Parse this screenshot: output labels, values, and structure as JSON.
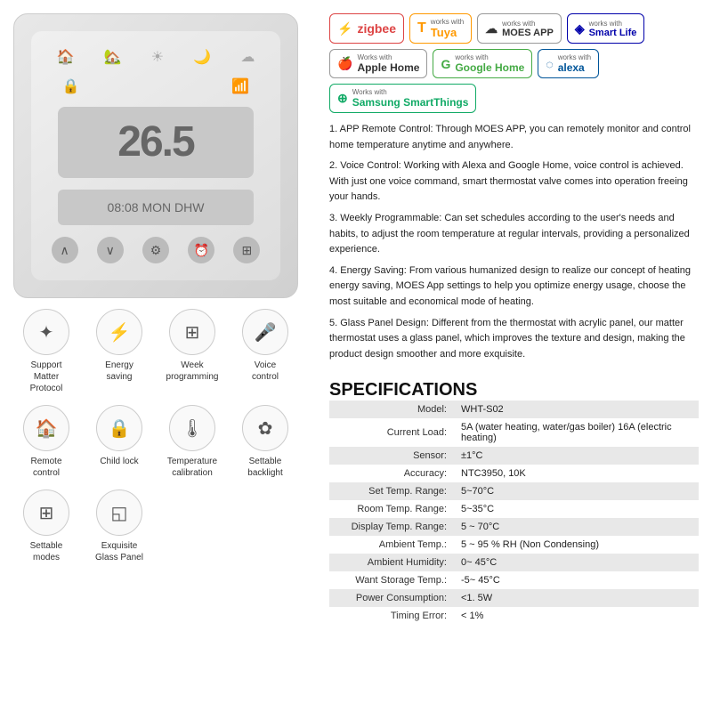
{
  "badges": {
    "row1": [
      {
        "label": "zigbee",
        "icon": "⚡",
        "text": "zigbee",
        "class": "zigbee"
      },
      {
        "label": "tuya",
        "icon": "T",
        "text": "works with\nTuya",
        "class": "tuya"
      },
      {
        "label": "moes",
        "icon": "☁",
        "text": "works with\nMOES APP",
        "class": "moes"
      },
      {
        "label": "smartlife",
        "icon": "◈",
        "text": "works with\nSmart Life",
        "class": "smartlife"
      }
    ],
    "row2": [
      {
        "label": "apple",
        "icon": "🍎",
        "text": "Works with\nApple Home",
        "class": "apple"
      },
      {
        "label": "google",
        "icon": "G",
        "text": "works with\nGoogle Home",
        "class": "google"
      },
      {
        "label": "alexa",
        "icon": "◌",
        "text": "works\nwith alexa",
        "class": "alexa"
      }
    ],
    "row3": [
      {
        "label": "samsung",
        "icon": "⊕",
        "text": "Works with\nSamsung SmartThings",
        "class": "samsung"
      }
    ]
  },
  "description": {
    "items": [
      "1. APP Remote Control: Through MOES APP, you can remotely monitor and control home temperature anytime and anywhere.",
      "2. Voice Control: Working with Alexa and Google Home, voice control is achieved. With just one voice command, smart thermostat valve comes into operation freeing your hands.",
      "3. Weekly Programmable: Can set schedules according to the user's needs and habits, to adjust the room temperature at regular intervals, providing a personalized experience.",
      "4. Energy Saving: From various humanized design to realize our concept of heating energy saving, MOES App settings to help you optimize energy usage, choose the most suitable and economical mode of heating.",
      "5. Glass Panel Design: Different from the thermostat with acrylic panel, our matter thermostat uses a glass panel, which improves the texture and design, making the product design smoother and more exquisite."
    ]
  },
  "specs": {
    "title": "SPECIFICATIONS",
    "rows": [
      {
        "label": "Model:",
        "value": "WHT-S02"
      },
      {
        "label": "Current Load:",
        "value": "5A (water heating, water/gas boiler)\n16A (electric heating)"
      },
      {
        "label": "Sensor:",
        "value": "±1°C"
      },
      {
        "label": "Accuracy:",
        "value": "NTC3950, 10K"
      },
      {
        "label": "Set Temp. Range:",
        "value": "5~70°C"
      },
      {
        "label": "Room Temp. Range:",
        "value": "5~35°C"
      },
      {
        "label": "Display Temp. Range:",
        "value": "5 ~ 70°C"
      },
      {
        "label": "Ambient Temp.:",
        "value": "5 ~ 95 % RH (Non Condensing)"
      },
      {
        "label": "Ambient Humidity:",
        "value": "0~ 45°C"
      },
      {
        "label": "Want Storage Temp.:",
        "value": "-5~ 45°C"
      },
      {
        "label": "Power Consumption:",
        "value": "<1. 5W"
      },
      {
        "label": "Timing Error:",
        "value": "< 1%"
      }
    ]
  },
  "features": {
    "row1": [
      {
        "label": "Support\nMatter Protocol",
        "icon": "✦"
      },
      {
        "label": "Energy\nsaving",
        "icon": "⚡"
      },
      {
        "label": "Week\nprogramming",
        "icon": "⊞"
      },
      {
        "label": "Voice\ncontrol",
        "icon": "🎤"
      }
    ],
    "row2": [
      {
        "label": "Remote control",
        "icon": "🏠"
      },
      {
        "label": "Child lock",
        "icon": "🔒"
      },
      {
        "label": "Temperature\ncalibration",
        "icon": "🌡"
      },
      {
        "label": "Settable\nbacklight",
        "icon": "✿"
      }
    ],
    "row3": [
      {
        "label": "Settable\nmodes",
        "icon": "⊞"
      },
      {
        "label": "Exquisite\nGlass Panel",
        "icon": "◱"
      }
    ]
  },
  "device": {
    "temp": "26.5",
    "sub": "08:08  MON  DHW"
  }
}
